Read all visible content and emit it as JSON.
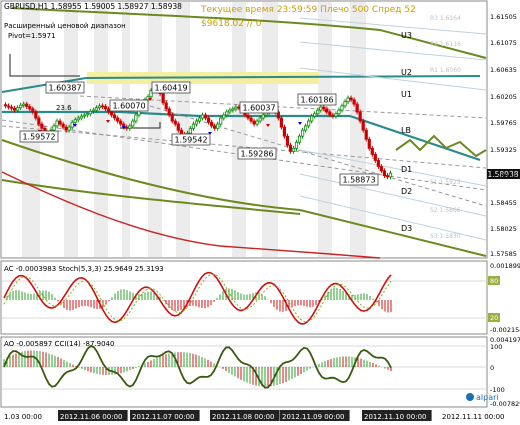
{
  "header": {
    "symbol_line": "GBPUSD,H1  1.58955 1.59005 1.58927 1.58938",
    "indicator_name": "Расширенный ценовой диапазон",
    "pivot": "Pivot=1.5971",
    "server_time": "Текущее время 23:59:59 Плечо 500 Спред 52",
    "balance": "$9618.02     // 0"
  },
  "level_labels": {
    "r3": "R3 1.6164",
    "r2": "R2 1.6116",
    "r1": "R1 1.6060",
    "s1": "S1 1.5923",
    "s2": "S2 1.5866",
    "s3": "S3 1.5830",
    "u3": "U3",
    "u2": "U2",
    "u1": "U1",
    "lb": "LB",
    "d1": "D1",
    "d2": "D2",
    "d3": "D3",
    "fib": "23.6"
  },
  "price_callouts": [
    "1.60387",
    "1.60070",
    "1.60419",
    "1.60037",
    "1.60186",
    "1.59572",
    "1.59542",
    "1.59286",
    "1.58873"
  ],
  "price_axis": [
    "1.61505",
    "1.61075",
    "1.60635",
    "1.60205",
    "1.59765",
    "1.59325",
    "1.58885",
    "1.58455",
    "1.58025",
    "1.57585"
  ],
  "current_price": "1.58938",
  "ac_panel": {
    "label": "AC -0.0003983  Stoch(5,3,3) 25.9649 25.3193",
    "axis": [
      "0.001899",
      "80",
      "20",
      "-0.002154"
    ]
  },
  "ao_panel": {
    "label": "AO -0.005897  CCI(14) -87.9040",
    "axis": [
      "0.004197",
      "100",
      "0",
      "-100",
      "-0.007829"
    ]
  },
  "time_axis": [
    "1.03 00:00",
    "2012.11.06 00:00",
    "2012.11.07 00:00",
    "2012.11.08 00:00",
    "2012.11.09 00:00",
    "2012.11.10 00:00",
    "2012.11.11 00:00"
  ],
  "watermark": "alpari",
  "colors": {
    "candle_up": "#0a8a0a",
    "candle_down": "#cc0000",
    "pivot_line": "#2b8a8a",
    "channel": "#6b8a1e",
    "highlight": "#f3eea0",
    "dashed": "#9a9a9a"
  },
  "chart_data": {
    "type": "candlestick",
    "title": "GBPUSD,H1",
    "close_series": [
      1.6005,
      1.6003,
      1.6001,
      1.5998,
      1.6002,
      1.6006,
      1.6008,
      1.6004,
      1.6,
      1.5995,
      1.5985,
      1.5975,
      1.5968,
      1.596,
      1.5958,
      1.5965,
      1.5972,
      1.598,
      1.5975,
      1.597,
      1.5965,
      1.597,
      1.5978,
      1.5982,
      1.5985,
      1.5988,
      1.599,
      1.5992,
      1.5996,
      1.5998,
      1.6002,
      1.6005,
      1.6004,
      1.6,
      1.5995,
      1.599,
      1.5985,
      1.598,
      1.5975,
      1.597,
      1.5968,
      1.5972,
      1.598,
      1.599,
      1.6,
      1.6008,
      1.6015,
      1.602,
      1.603,
      1.604,
      1.6035,
      1.6025,
      1.601,
      1.6,
      1.599,
      1.598,
      1.5975,
      1.5965,
      1.5958,
      1.5955,
      1.596,
      1.5968,
      1.5975,
      1.598,
      1.5985,
      1.599,
      1.5985,
      1.5978,
      1.5972,
      1.5968,
      1.5975,
      1.5985,
      1.599,
      1.5995,
      1.5998,
      1.6,
      1.6003,
      1.6002,
      1.5998,
      1.599,
      1.5985,
      1.598,
      1.5975,
      1.598,
      1.5985,
      1.599,
      1.5994,
      1.5998,
      1.6,
      1.5995,
      1.5985,
      1.597,
      1.5955,
      1.594,
      1.593,
      1.5935,
      1.5945,
      1.5955,
      1.5965,
      1.5972,
      1.598,
      1.5988,
      1.5992,
      1.5998,
      1.6003,
      1.6,
      1.5995,
      1.599,
      1.5988,
      1.5992,
      1.5998,
      1.6005,
      1.6012,
      1.6018,
      1.6015,
      1.6008,
      1.5995,
      1.598,
      1.5965,
      1.595,
      1.5935,
      1.5925,
      1.5915,
      1.5905,
      1.5898,
      1.589,
      1.5888,
      1.5894
    ]
  }
}
